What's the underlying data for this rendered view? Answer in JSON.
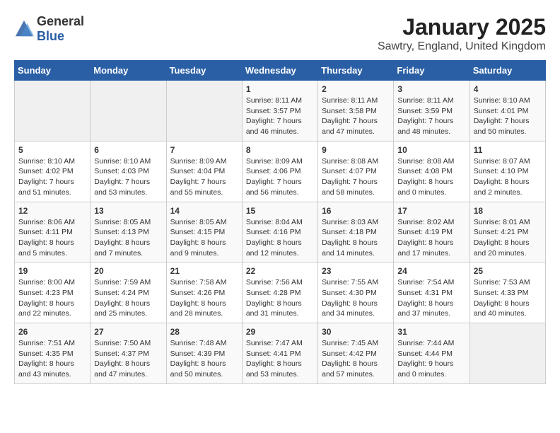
{
  "header": {
    "logo_general": "General",
    "logo_blue": "Blue",
    "month_year": "January 2025",
    "location": "Sawtry, England, United Kingdom"
  },
  "days_of_week": [
    "Sunday",
    "Monday",
    "Tuesday",
    "Wednesday",
    "Thursday",
    "Friday",
    "Saturday"
  ],
  "weeks": [
    [
      {
        "day": "",
        "content": ""
      },
      {
        "day": "",
        "content": ""
      },
      {
        "day": "",
        "content": ""
      },
      {
        "day": "1",
        "content": "Sunrise: 8:11 AM\nSunset: 3:57 PM\nDaylight: 7 hours and 46 minutes."
      },
      {
        "day": "2",
        "content": "Sunrise: 8:11 AM\nSunset: 3:58 PM\nDaylight: 7 hours and 47 minutes."
      },
      {
        "day": "3",
        "content": "Sunrise: 8:11 AM\nSunset: 3:59 PM\nDaylight: 7 hours and 48 minutes."
      },
      {
        "day": "4",
        "content": "Sunrise: 8:10 AM\nSunset: 4:01 PM\nDaylight: 7 hours and 50 minutes."
      }
    ],
    [
      {
        "day": "5",
        "content": "Sunrise: 8:10 AM\nSunset: 4:02 PM\nDaylight: 7 hours and 51 minutes."
      },
      {
        "day": "6",
        "content": "Sunrise: 8:10 AM\nSunset: 4:03 PM\nDaylight: 7 hours and 53 minutes."
      },
      {
        "day": "7",
        "content": "Sunrise: 8:09 AM\nSunset: 4:04 PM\nDaylight: 7 hours and 55 minutes."
      },
      {
        "day": "8",
        "content": "Sunrise: 8:09 AM\nSunset: 4:06 PM\nDaylight: 7 hours and 56 minutes."
      },
      {
        "day": "9",
        "content": "Sunrise: 8:08 AM\nSunset: 4:07 PM\nDaylight: 7 hours and 58 minutes."
      },
      {
        "day": "10",
        "content": "Sunrise: 8:08 AM\nSunset: 4:08 PM\nDaylight: 8 hours and 0 minutes."
      },
      {
        "day": "11",
        "content": "Sunrise: 8:07 AM\nSunset: 4:10 PM\nDaylight: 8 hours and 2 minutes."
      }
    ],
    [
      {
        "day": "12",
        "content": "Sunrise: 8:06 AM\nSunset: 4:11 PM\nDaylight: 8 hours and 5 minutes."
      },
      {
        "day": "13",
        "content": "Sunrise: 8:05 AM\nSunset: 4:13 PM\nDaylight: 8 hours and 7 minutes."
      },
      {
        "day": "14",
        "content": "Sunrise: 8:05 AM\nSunset: 4:15 PM\nDaylight: 8 hours and 9 minutes."
      },
      {
        "day": "15",
        "content": "Sunrise: 8:04 AM\nSunset: 4:16 PM\nDaylight: 8 hours and 12 minutes."
      },
      {
        "day": "16",
        "content": "Sunrise: 8:03 AM\nSunset: 4:18 PM\nDaylight: 8 hours and 14 minutes."
      },
      {
        "day": "17",
        "content": "Sunrise: 8:02 AM\nSunset: 4:19 PM\nDaylight: 8 hours and 17 minutes."
      },
      {
        "day": "18",
        "content": "Sunrise: 8:01 AM\nSunset: 4:21 PM\nDaylight: 8 hours and 20 minutes."
      }
    ],
    [
      {
        "day": "19",
        "content": "Sunrise: 8:00 AM\nSunset: 4:23 PM\nDaylight: 8 hours and 22 minutes."
      },
      {
        "day": "20",
        "content": "Sunrise: 7:59 AM\nSunset: 4:24 PM\nDaylight: 8 hours and 25 minutes."
      },
      {
        "day": "21",
        "content": "Sunrise: 7:58 AM\nSunset: 4:26 PM\nDaylight: 8 hours and 28 minutes."
      },
      {
        "day": "22",
        "content": "Sunrise: 7:56 AM\nSunset: 4:28 PM\nDaylight: 8 hours and 31 minutes."
      },
      {
        "day": "23",
        "content": "Sunrise: 7:55 AM\nSunset: 4:30 PM\nDaylight: 8 hours and 34 minutes."
      },
      {
        "day": "24",
        "content": "Sunrise: 7:54 AM\nSunset: 4:31 PM\nDaylight: 8 hours and 37 minutes."
      },
      {
        "day": "25",
        "content": "Sunrise: 7:53 AM\nSunset: 4:33 PM\nDaylight: 8 hours and 40 minutes."
      }
    ],
    [
      {
        "day": "26",
        "content": "Sunrise: 7:51 AM\nSunset: 4:35 PM\nDaylight: 8 hours and 43 minutes."
      },
      {
        "day": "27",
        "content": "Sunrise: 7:50 AM\nSunset: 4:37 PM\nDaylight: 8 hours and 47 minutes."
      },
      {
        "day": "28",
        "content": "Sunrise: 7:48 AM\nSunset: 4:39 PM\nDaylight: 8 hours and 50 minutes."
      },
      {
        "day": "29",
        "content": "Sunrise: 7:47 AM\nSunset: 4:41 PM\nDaylight: 8 hours and 53 minutes."
      },
      {
        "day": "30",
        "content": "Sunrise: 7:45 AM\nSunset: 4:42 PM\nDaylight: 8 hours and 57 minutes."
      },
      {
        "day": "31",
        "content": "Sunrise: 7:44 AM\nSunset: 4:44 PM\nDaylight: 9 hours and 0 minutes."
      },
      {
        "day": "",
        "content": ""
      }
    ]
  ]
}
